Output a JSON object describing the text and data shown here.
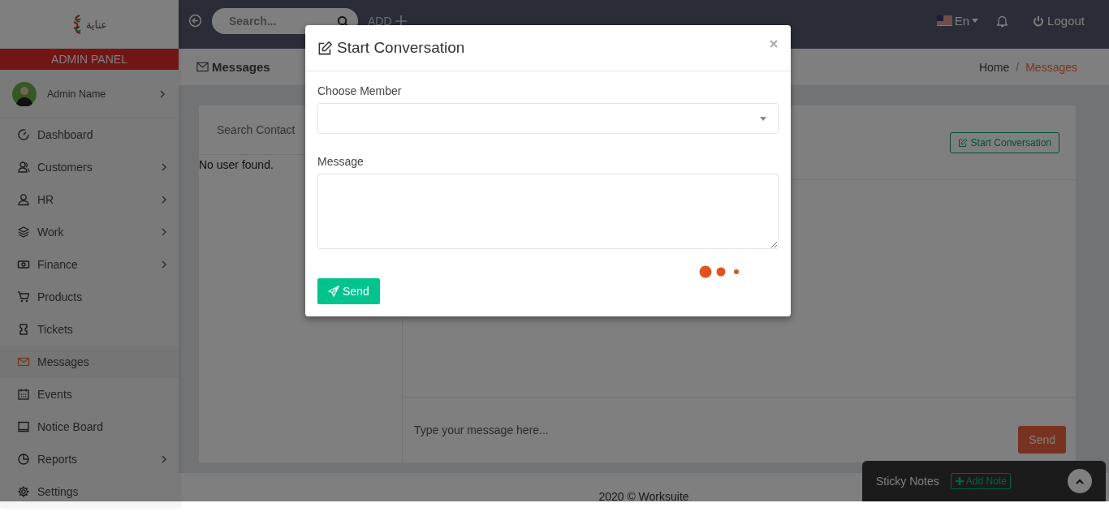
{
  "logo": {
    "text": "عناية"
  },
  "sidebar": {
    "banner": "ADMIN PANEL",
    "user": {
      "name": "Admin Name",
      "has_submenu": true
    },
    "items": [
      {
        "label": "Dashboard",
        "has_submenu": false,
        "selected": false
      },
      {
        "label": "Customers",
        "has_submenu": true,
        "selected": false
      },
      {
        "label": "HR",
        "has_submenu": true,
        "selected": false
      },
      {
        "label": "Work",
        "has_submenu": true,
        "selected": false
      },
      {
        "label": "Finance",
        "has_submenu": true,
        "selected": false
      },
      {
        "label": "Products",
        "has_submenu": false,
        "selected": false
      },
      {
        "label": "Tickets",
        "has_submenu": false,
        "selected": false
      },
      {
        "label": "Messages",
        "has_submenu": false,
        "selected": true
      },
      {
        "label": "Events",
        "has_submenu": false,
        "selected": false
      },
      {
        "label": "Notice Board",
        "has_submenu": false,
        "selected": false
      },
      {
        "label": "Reports",
        "has_submenu": true,
        "selected": false
      },
      {
        "label": "Settings",
        "has_submenu": false,
        "selected": false
      }
    ]
  },
  "topbar": {
    "search": {
      "placeholder": "Search..."
    },
    "add_label": "ADD",
    "language": "En",
    "logout": "Logout"
  },
  "page": {
    "title": "Messages",
    "breadcrumb_separator": "/",
    "breadcrumb": [
      {
        "label": "Home",
        "selected": false
      },
      {
        "label": "Messages",
        "selected": true
      }
    ]
  },
  "contacts": {
    "search_placeholder": "Search Contact",
    "empty_text": "No user found."
  },
  "chat": {
    "start_button": "Start Conversation",
    "message_placeholder": "Type your message here...",
    "send_button": "Send"
  },
  "footer": "2020 © Worksuite",
  "sticky_notes": {
    "title": "Sticky Notes",
    "add_button": "Add Note"
  },
  "modal": {
    "title": "Start Conversation",
    "fields": [
      {
        "kind": "select",
        "label": "Choose Member"
      },
      {
        "kind": "textarea",
        "label": "Message"
      }
    ],
    "send_button": "Send"
  }
}
